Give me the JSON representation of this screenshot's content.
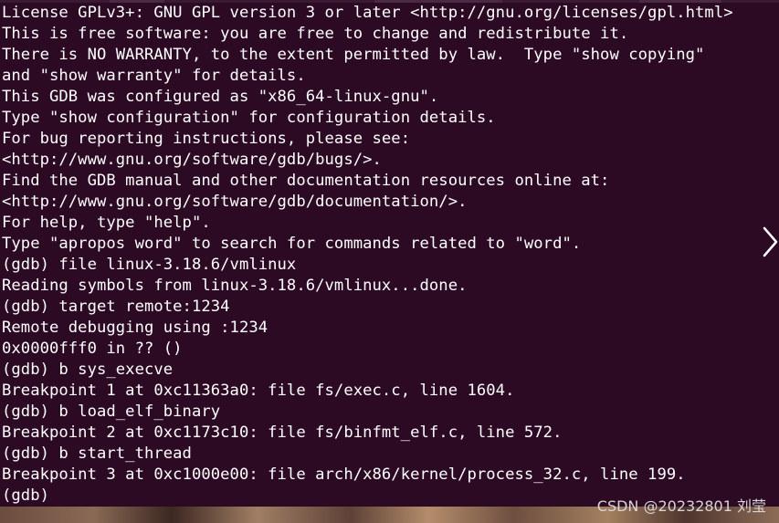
{
  "terminal": {
    "lines": [
      "License GPLv3+: GNU GPL version 3 or later <http://gnu.org/licenses/gpl.html>",
      "This is free software: you are free to change and redistribute it.",
      "There is NO WARRANTY, to the extent permitted by law.  Type \"show copying\"",
      "and \"show warranty\" for details.",
      "This GDB was configured as \"x86_64-linux-gnu\".",
      "Type \"show configuration\" for configuration details.",
      "For bug reporting instructions, please see:",
      "<http://www.gnu.org/software/gdb/bugs/>.",
      "Find the GDB manual and other documentation resources online at:",
      "<http://www.gnu.org/software/gdb/documentation/>.",
      "For help, type \"help\".",
      "Type \"apropos word\" to search for commands related to \"word\".",
      "(gdb) file linux-3.18.6/vmlinux",
      "Reading symbols from linux-3.18.6/vmlinux...done.",
      "(gdb) target remote:1234",
      "Remote debugging using :1234",
      "0x0000fff0 in ?? ()",
      "(gdb) b sys_execve",
      "Breakpoint 1 at 0xc11363a0: file fs/exec.c, line 1604.",
      "(gdb) b load_elf_binary",
      "Breakpoint 2 at 0xc1173c10: file fs/binfmt_elf.c, line 572.",
      "(gdb) b start_thread",
      "Breakpoint 3 at 0xc1000e00: file arch/x86/kernel/process_32.c, line 199.",
      "(gdb)"
    ]
  },
  "watermark": "CSDN @20232801 刘莹",
  "icons": {
    "right_arrow": "chevron-right-icon"
  },
  "colors": {
    "terminal_bg": "#2c0a24",
    "terminal_fg": "#ffffff"
  }
}
